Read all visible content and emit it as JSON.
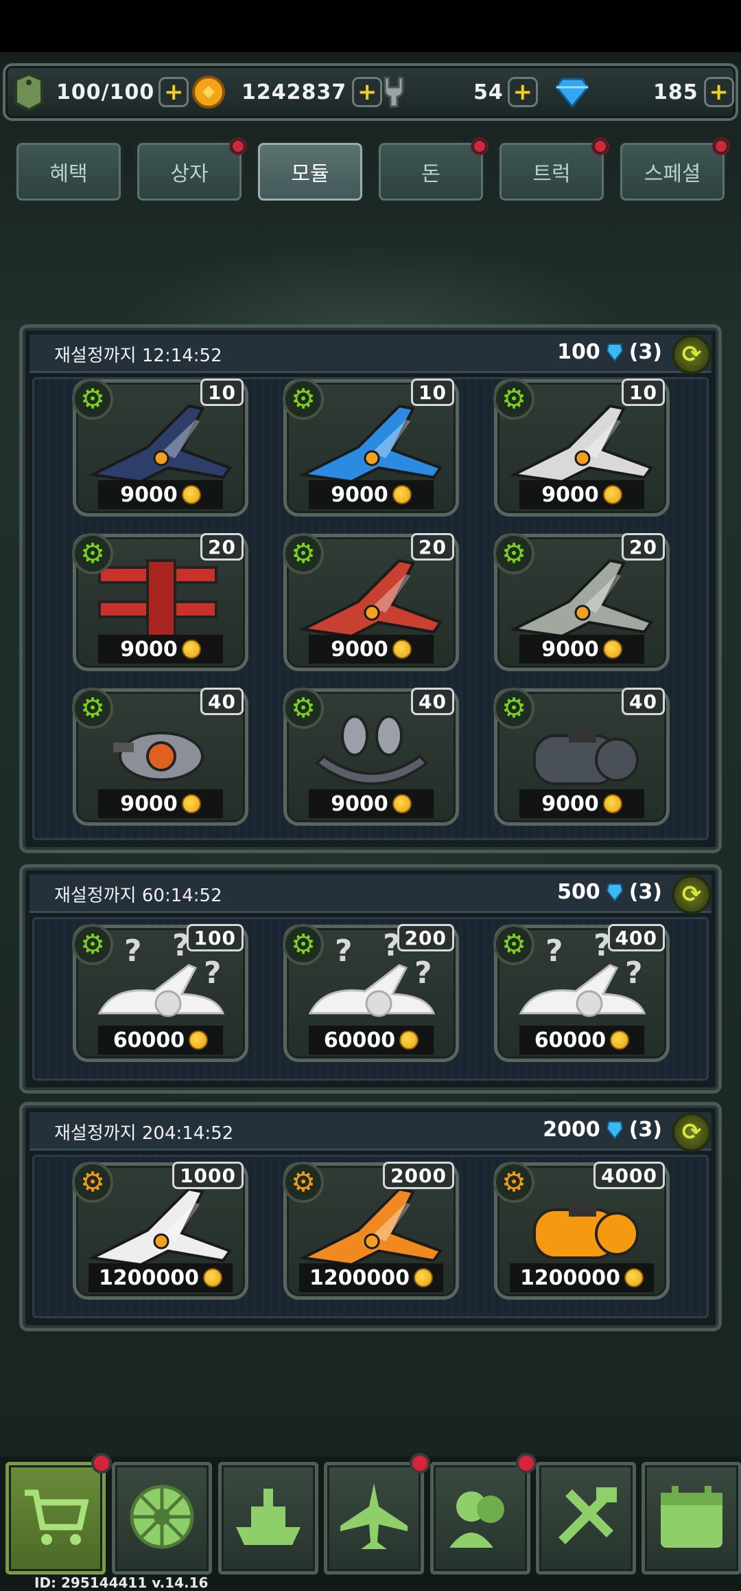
{
  "resources": {
    "energy": "100/100",
    "coins": "1242837",
    "parts": "54",
    "gems": "185"
  },
  "tabs": [
    {
      "label": "혜택",
      "badge": false,
      "active": false
    },
    {
      "label": "상자",
      "badge": true,
      "active": false
    },
    {
      "label": "모듈",
      "badge": false,
      "active": true
    },
    {
      "label": "돈",
      "badge": true,
      "active": false
    },
    {
      "label": "트럭",
      "badge": true,
      "active": false
    },
    {
      "label": "스페셜",
      "badge": true,
      "active": false
    }
  ],
  "panels": [
    {
      "timer": "재설정까지 12:14:52",
      "cost": "100",
      "count": "(3)",
      "items": [
        {
          "level": "10",
          "price": "9000",
          "icon": "navy-fighter-jet",
          "color": "#2d3e6a"
        },
        {
          "level": "10",
          "price": "9000",
          "icon": "blue-jet",
          "color": "#2a8be0"
        },
        {
          "level": "10",
          "price": "9000",
          "icon": "white-red-jet",
          "color": "#d9d9d9"
        },
        {
          "level": "20",
          "price": "9000",
          "icon": "red-biplane",
          "color": "#c8322a"
        },
        {
          "level": "20",
          "price": "9000",
          "icon": "red-silver-planes",
          "color": "#c84030"
        },
        {
          "level": "20",
          "price": "9000",
          "icon": "grey-yellow-plane",
          "color": "#a0a8a0"
        },
        {
          "level": "40",
          "price": "9000",
          "icon": "drone-pod",
          "color": "#8a8f98"
        },
        {
          "level": "40",
          "price": "9000",
          "icon": "twin-turret",
          "color": "#5a5f6a"
        },
        {
          "level": "40",
          "price": "9000",
          "icon": "engine-block",
          "color": "#4a5058"
        }
      ]
    },
    {
      "timer": "재설정까지 60:14:52",
      "cost": "500",
      "count": "(3)",
      "items": [
        {
          "level": "100",
          "price": "60000",
          "icon": "mystery-plane",
          "color": "#e6e6e6"
        },
        {
          "level": "200",
          "price": "60000",
          "icon": "mystery-planes",
          "color": "#e6e6e6"
        },
        {
          "level": "400",
          "price": "60000",
          "icon": "mystery-module",
          "color": "#e6e6e6"
        }
      ]
    },
    {
      "timer": "재설정까지 204:14:52",
      "cost": "2000",
      "count": "(3)",
      "items": [
        {
          "level": "1000",
          "price": "1200000",
          "icon": "white-plane",
          "color": "#eeeeee"
        },
        {
          "level": "2000",
          "price": "1200000",
          "icon": "orange-planes",
          "color": "#f08a20"
        },
        {
          "level": "4000",
          "price": "1200000",
          "icon": "orange-module",
          "color": "#f59a10"
        }
      ]
    }
  ],
  "nav": [
    {
      "icon": "cart-icon",
      "active": true,
      "badge": true
    },
    {
      "icon": "wheel-icon",
      "active": false,
      "badge": false
    },
    {
      "icon": "ship-icon",
      "active": false,
      "badge": false
    },
    {
      "icon": "jet-icon",
      "active": false,
      "badge": true
    },
    {
      "icon": "crew-icon",
      "active": false,
      "badge": true
    },
    {
      "icon": "tools-icon",
      "active": false,
      "badge": false
    },
    {
      "icon": "calendar-icon",
      "active": false,
      "badge": false
    }
  ],
  "footer": "ID: 295144411  v.14.16"
}
